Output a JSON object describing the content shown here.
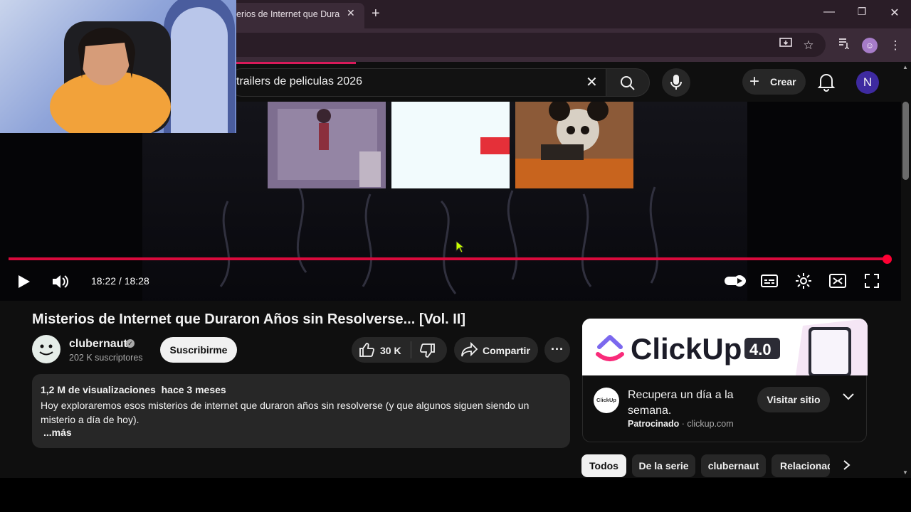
{
  "browser": {
    "tab_title": "Misterios de Internet que Duraron Años sin Resolverse",
    "tab_visible_title": "erios de Internet que Duran",
    "window_controls": [
      "minimize-icon",
      "restore-icon",
      "close-icon"
    ],
    "toolbar_icons": [
      "install-app-icon",
      "bookmark-star-icon",
      "media-queue-icon",
      "extension-profile-icon",
      "more-menu-icon"
    ]
  },
  "youtube": {
    "search_query": "trailers de peliculas 2026",
    "create_label": "Crear",
    "avatar_letter": "N"
  },
  "player": {
    "time_display": "18:22 / 18:28",
    "progress_fraction": 0.995,
    "autoplay": true
  },
  "video": {
    "title": "Misterios de Internet que Duraron Años sin Resolverse... [Vol. II]",
    "channel_name": "clubernaut",
    "subscribers": "202 K suscriptores",
    "subscribe_label": "Suscribirme",
    "like_count": "30 K",
    "share_label": "Compartir",
    "description_meta": "1,2 M de visualizaciones  hace 3 meses",
    "description_text": "Hoy exploraremos esos misterios de internet que duraron años sin resolverse (y que algunos siguen siendo un misterio a día de hoy).",
    "description_more": "...más"
  },
  "ad": {
    "brand": "ClickUp",
    "version_badge": "4.0",
    "small_logo_text": "ClickUp",
    "headline": "Recupera un día a la semana.",
    "sponsored_label": "Patrocinado",
    "domain": "clickup.com",
    "visit_label": "Visitar sitio"
  },
  "chips": [
    "Todos",
    "De la serie",
    "clubernaut",
    "Relacionad"
  ],
  "colors": {
    "accent_red": "#ff0033",
    "tab_bar": "#2a1d27",
    "yt_bg": "#0f0f0f"
  }
}
